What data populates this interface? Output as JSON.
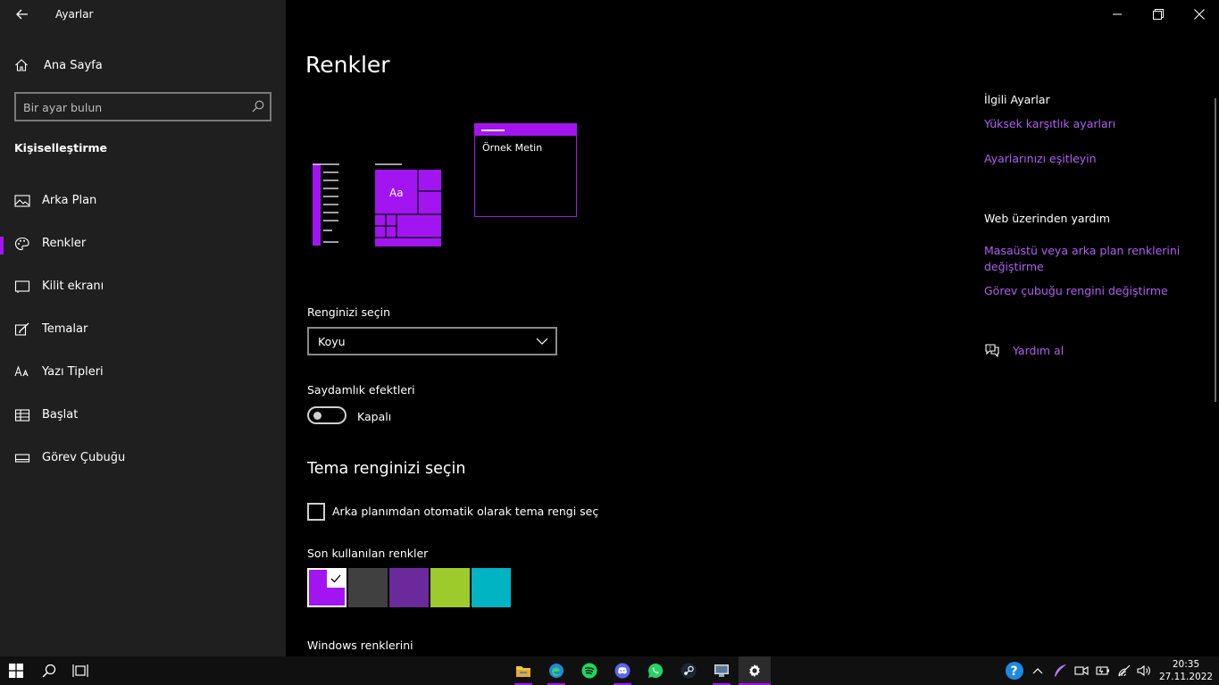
{
  "window": {
    "title": "Ayarlar",
    "controls": [
      "minimize",
      "restore",
      "close"
    ]
  },
  "sidebar": {
    "home_label": "Ana Sayfa",
    "search_placeholder": "Bir ayar bulun",
    "section_title": "Kişiselleştirme",
    "items": [
      {
        "label": "Arka Plan",
        "icon": "picture-icon"
      },
      {
        "label": "Renkler",
        "icon": "palette-icon",
        "active": true
      },
      {
        "label": "Kilit ekranı",
        "icon": "lock-screen-icon"
      },
      {
        "label": "Temalar",
        "icon": "brush-icon"
      },
      {
        "label": "Yazı Tipleri",
        "icon": "fonts-icon"
      },
      {
        "label": "Başlat",
        "icon": "start-grid-icon"
      },
      {
        "label": "Görev Çubuğu",
        "icon": "taskbar-icon"
      }
    ]
  },
  "main": {
    "title": "Renkler",
    "preview": {
      "tile_text": "Aa",
      "sample_text": "Örnek Metin"
    },
    "choose_color_label": "Renginizi seçin",
    "choose_color_value": "Koyu",
    "transparency_label": "Saydamlık efektleri",
    "transparency_state": "Kapalı",
    "transparency_on": false,
    "theme_heading": "Tema renginizi seçin",
    "auto_color_label": "Arka planımdan otomatik olarak tema rengi seç",
    "auto_color_checked": false,
    "recent_colors_label": "Son kullanılan renkler",
    "recent_colors": [
      "#a315f0",
      "#404040",
      "#6b2a9b",
      "#9ccb2b",
      "#00b4c4"
    ],
    "selected_color_index": 0,
    "windows_colors_label": "Windows renklerini"
  },
  "related": {
    "heading": "İlgili Ayarlar",
    "links": [
      "Yüksek karşıtlık ayarları",
      "Ayarlarınızı eşitleyin"
    ],
    "web_help_heading": "Web üzerinden yardım",
    "web_links": [
      "Masaüstü veya arka plan renklerini değiştirme",
      "Görev çubuğu rengini değiştirme"
    ],
    "help_label": "Yardım al"
  },
  "taskbar": {
    "pinned": [
      "file-explorer-icon",
      "edge-icon",
      "spotify-icon",
      "discord-icon",
      "whatsapp-icon",
      "steam-icon",
      "remote-desktop-icon",
      "settings-icon"
    ],
    "time": "20:35",
    "date": "27.11.2022"
  },
  "colors": {
    "accent": "#a315f0",
    "link": "#b15ef2",
    "sidebar_bg": "#1f1f1f",
    "main_bg": "#000000"
  }
}
